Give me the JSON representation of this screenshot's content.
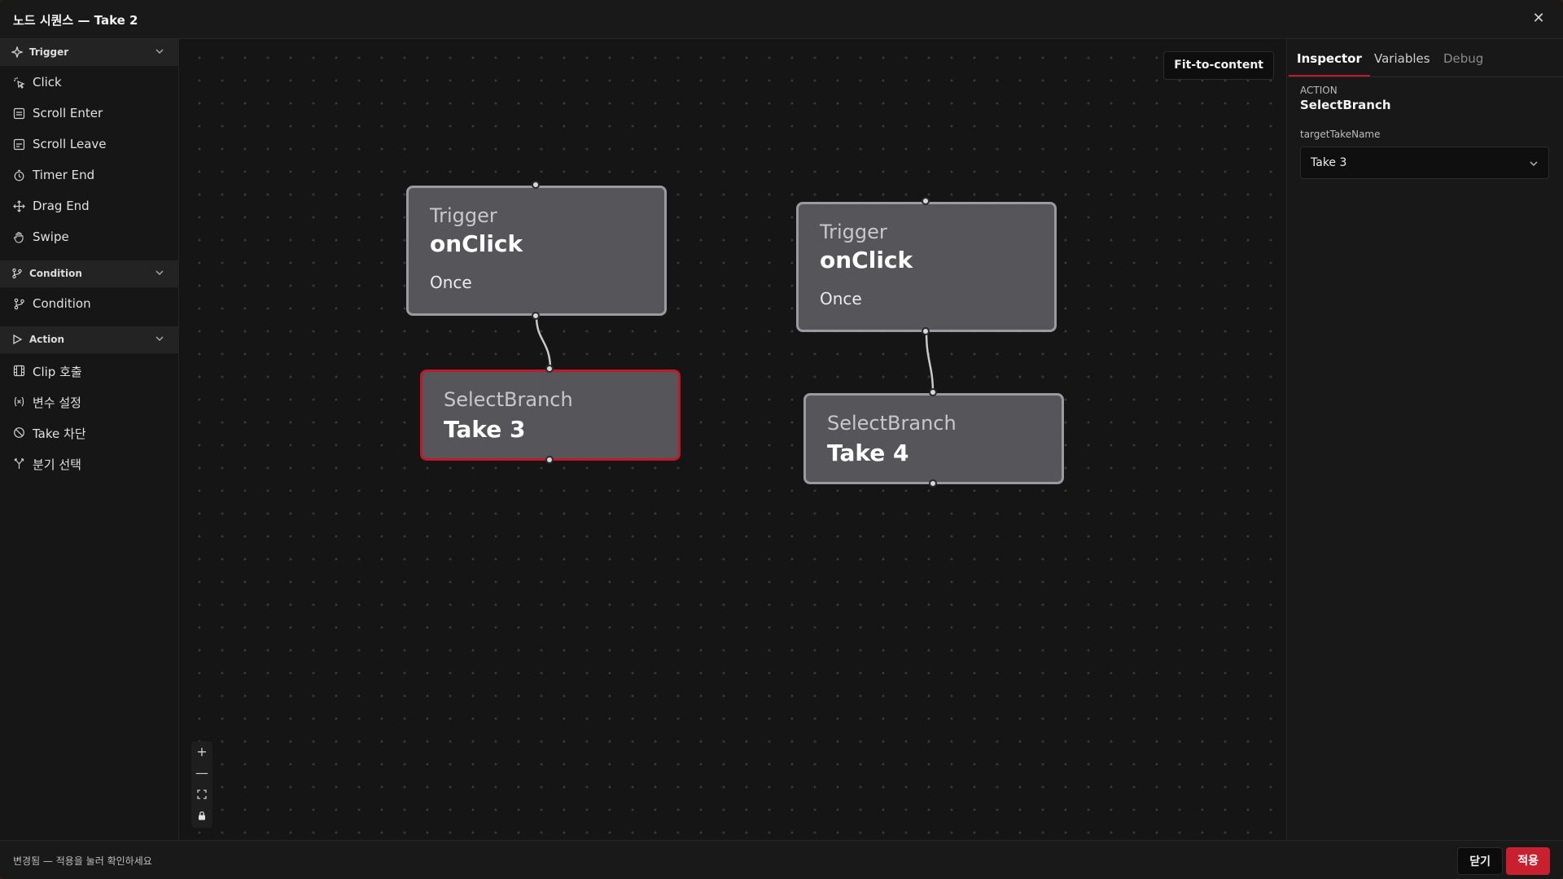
{
  "window": {
    "title": "노드 시퀀스 — Take 2",
    "close_glyph": "✕"
  },
  "sidebar": {
    "sections": [
      {
        "label": "Trigger",
        "items": [
          {
            "label": "Click",
            "icon": "click-icon"
          },
          {
            "label": "Scroll Enter",
            "icon": "scroll-enter-icon"
          },
          {
            "label": "Scroll Leave",
            "icon": "scroll-leave-icon"
          },
          {
            "label": "Timer End",
            "icon": "timer-icon"
          },
          {
            "label": "Drag End",
            "icon": "move-icon"
          },
          {
            "label": "Swipe",
            "icon": "hand-icon"
          }
        ]
      },
      {
        "label": "Condition",
        "items": [
          {
            "label": "Condition",
            "icon": "branch-icon"
          }
        ]
      },
      {
        "label": "Action",
        "items": [
          {
            "label": "Clip 호출",
            "icon": "film-icon"
          },
          {
            "label": "변수 설정",
            "icon": "variable-icon"
          },
          {
            "label": "Take 차단",
            "icon": "block-icon"
          },
          {
            "label": "분기 선택",
            "icon": "fork-icon"
          }
        ]
      }
    ]
  },
  "canvas": {
    "fit_button": "Fit-to-content",
    "nodes": [
      {
        "kind": "Trigger",
        "name": "onClick",
        "sub": "Once"
      },
      {
        "kind": "SelectBranch",
        "name": "Take 3",
        "selected": true
      },
      {
        "kind": "Trigger",
        "name": "onClick",
        "sub": "Once"
      },
      {
        "kind": "SelectBranch",
        "name": "Take 4",
        "selected": false
      }
    ],
    "zoom_controls": {
      "zoom_in": "+",
      "zoom_out": "—",
      "fit": "⛶",
      "lock": "🔒"
    }
  },
  "inspector": {
    "tabs": [
      "Inspector",
      "Variables",
      "Debug"
    ],
    "active_tab": "Inspector",
    "action_label": "ACTION",
    "action_value": "SelectBranch",
    "field_label": "targetTakeName",
    "field_value": "Take 3"
  },
  "footer": {
    "status": "변경됨 — 적용을 눌러 확인하세요",
    "close_label": "닫기",
    "apply_label": "적용"
  },
  "colors": {
    "accent": "#c8202e",
    "node_fill": "#55555a",
    "node_border": "#9a9aa0",
    "selected_border": "#c0192b"
  }
}
